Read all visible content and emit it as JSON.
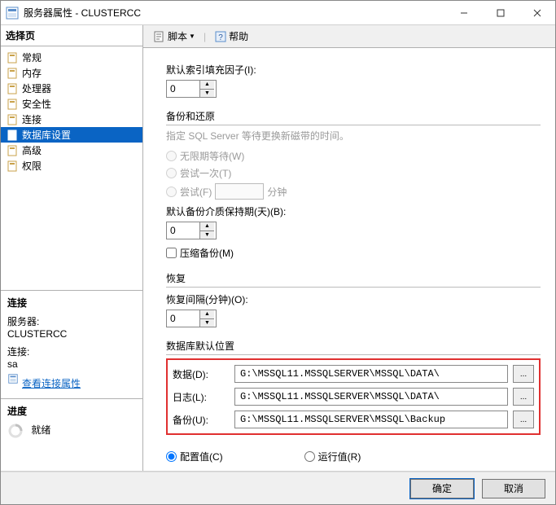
{
  "window": {
    "title": "服务器属性 - CLUSTERCC"
  },
  "sidebar": {
    "header": "选择页",
    "items": [
      {
        "label": "常规"
      },
      {
        "label": "内存"
      },
      {
        "label": "处理器"
      },
      {
        "label": "安全性"
      },
      {
        "label": "连接"
      },
      {
        "label": "数据库设置",
        "selected": true
      },
      {
        "label": "高级"
      },
      {
        "label": "权限"
      }
    ]
  },
  "connection": {
    "header": "连接",
    "server_label": "服务器:",
    "server_value": "CLUSTERCC",
    "conn_label": "连接:",
    "conn_value": "sa",
    "view_props": "查看连接属性"
  },
  "progress": {
    "header": "进度",
    "status": "就绪"
  },
  "toolbar": {
    "script": "脚本",
    "help": "帮助"
  },
  "main": {
    "fillfactor_label": "默认索引填充因子(I):",
    "fillfactor_value": "0",
    "backup_restore_header": "备份和还原",
    "tape_hint": "指定 SQL Server 等待更换新磁带的时间。",
    "wait_infinite": "无限期等待(W)",
    "try_once": "尝试一次(T)",
    "try_label": "尝试(F)",
    "try_value": "",
    "minutes": "分钟",
    "retention_label": "默认备份介质保持期(天)(B):",
    "retention_value": "0",
    "compress": "压缩备份(M)",
    "recovery_header": "恢复",
    "recovery_interval_label": "恢复间隔(分钟)(O):",
    "recovery_interval_value": "0",
    "default_loc_header": "数据库默认位置",
    "data_label": "数据(D):",
    "data_value": "G:\\MSSQL11.MSSQLSERVER\\MSSQL\\DATA\\",
    "log_label": "日志(L):",
    "log_value": "G:\\MSSQL11.MSSQLSERVER\\MSSQL\\DATA\\",
    "backup_label": "备份(U):",
    "backup_value": "G:\\MSSQL11.MSSQLSERVER\\MSSQL\\Backup",
    "browse": "...",
    "configured": "配置值(C)",
    "running": "运行值(R)"
  },
  "footer": {
    "ok": "确定",
    "cancel": "取消"
  }
}
